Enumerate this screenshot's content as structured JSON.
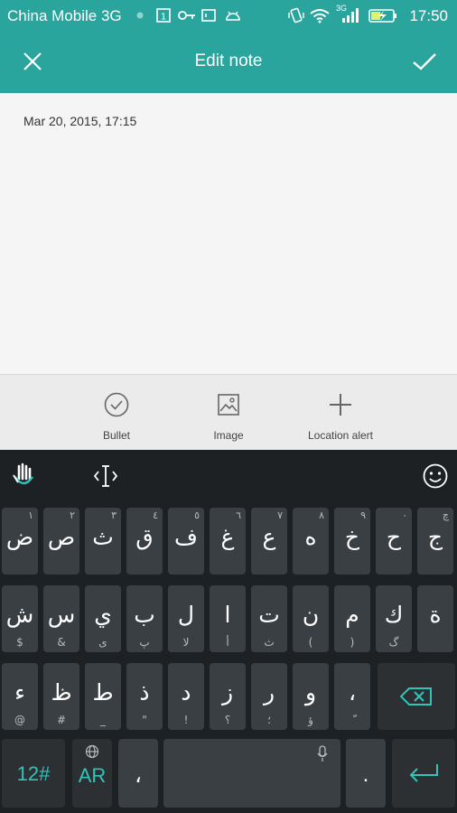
{
  "status_bar": {
    "carrier": "China Mobile 3G",
    "time": "17:50",
    "network": "3G",
    "icons": [
      "signal-dot-icon",
      "sim-1-icon",
      "key-icon",
      "screen-icon",
      "android-icon",
      "vibrate-icon",
      "wifi-icon",
      "signal-bars-icon",
      "battery-charging-icon"
    ]
  },
  "header": {
    "title": "Edit note",
    "close_icon": "close-icon",
    "confirm_icon": "check-icon",
    "color": "#2aa59e"
  },
  "note": {
    "date": "Mar 20, 2015, 17:15"
  },
  "toolbar": {
    "items": [
      {
        "label": "Bullet",
        "icon": "checkmark-circle-icon"
      },
      {
        "label": "Image",
        "icon": "image-icon"
      },
      {
        "label": "Location alert",
        "icon": "plus-icon"
      }
    ]
  },
  "keyboard": {
    "accent": "#30c4bb",
    "row1": [
      {
        "main": "ض",
        "hint": "١"
      },
      {
        "main": "ص",
        "hint": "٢"
      },
      {
        "main": "ث",
        "hint": "٣"
      },
      {
        "main": "ق",
        "hint": "٤"
      },
      {
        "main": "ف",
        "hint": "٥"
      },
      {
        "main": "غ",
        "hint": "٦"
      },
      {
        "main": "ع",
        "hint": "٧"
      },
      {
        "main": "ه",
        "hint": "٨"
      },
      {
        "main": "خ",
        "hint": "٩"
      },
      {
        "main": "ح",
        "hint": "٠"
      },
      {
        "main": "ج",
        "hint": "چ"
      }
    ],
    "row2": [
      {
        "main": "ش",
        "sub": "$"
      },
      {
        "main": "س",
        "sub": "&"
      },
      {
        "main": "ي",
        "sub": "ى"
      },
      {
        "main": "ب",
        "sub": "پ"
      },
      {
        "main": "ل",
        "sub": "لا"
      },
      {
        "main": "ا",
        "sub": "أ"
      },
      {
        "main": "ت",
        "sub": "ث"
      },
      {
        "main": "ن",
        "sub": "("
      },
      {
        "main": "م",
        "sub": ")"
      },
      {
        "main": "ك",
        "sub": "گ"
      },
      {
        "main": "ة",
        "sub": ""
      }
    ],
    "row3": [
      {
        "main": "ء",
        "sub": "@"
      },
      {
        "main": "ظ",
        "sub": "#"
      },
      {
        "main": "ط",
        "sub": "_"
      },
      {
        "main": "ذ",
        "sub": "\""
      },
      {
        "main": "د",
        "sub": "!"
      },
      {
        "main": "ز",
        "sub": "؟"
      },
      {
        "main": "ر",
        "sub": "؛"
      },
      {
        "main": "و",
        "sub": "ؤ"
      },
      {
        "main": "،",
        "sub": "ّ"
      }
    ],
    "bottom": {
      "numbers": "12#",
      "language": "AR",
      "comma": "،",
      "period": "."
    }
  }
}
